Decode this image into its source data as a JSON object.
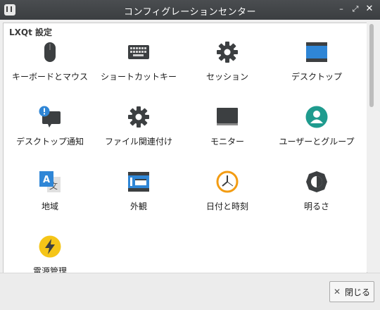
{
  "window": {
    "title": "コンフィグレーションセンター",
    "buttons": {
      "minimize": "–",
      "maximize": "⤢",
      "close": "✕"
    }
  },
  "group": {
    "title": "LXQt 設定"
  },
  "items": [
    {
      "label": "キーボードとマウス",
      "icon": "mouse-icon"
    },
    {
      "label": "ショートカットキー",
      "icon": "keyboard-icon"
    },
    {
      "label": "セッション",
      "icon": "gear-icon"
    },
    {
      "label": "デスクトップ",
      "icon": "desktop-icon"
    },
    {
      "label": "デスクトップ通知",
      "icon": "notification-icon"
    },
    {
      "label": "ファイル関連付け",
      "icon": "gear-icon"
    },
    {
      "label": "モニター",
      "icon": "monitor-icon"
    },
    {
      "label": "ユーザーとグループ",
      "icon": "user-icon"
    },
    {
      "label": "地域",
      "icon": "translate-icon"
    },
    {
      "label": "外観",
      "icon": "appearance-icon"
    },
    {
      "label": "日付と時刻",
      "icon": "clock-icon"
    },
    {
      "label": "明るさ",
      "icon": "brightness-icon"
    },
    {
      "label": "電源管理",
      "icon": "power-icon"
    }
  ],
  "footer": {
    "close_label": "閉じる",
    "close_icon": "✕"
  },
  "colors": {
    "titlebar": "#3b3e41",
    "blue": "#2f86d6",
    "teal": "#1f9b8e",
    "orange": "#f39c12",
    "yellow": "#f5c518",
    "dark": "#3c3f41"
  }
}
